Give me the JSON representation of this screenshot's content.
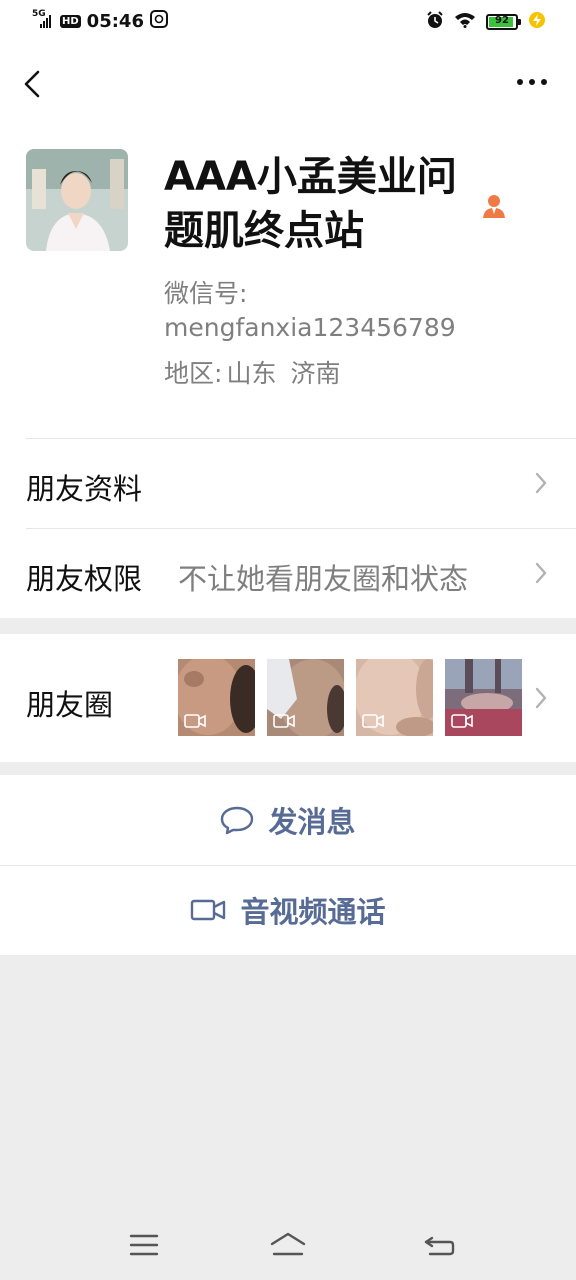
{
  "status_bar": {
    "network": "5G",
    "hd": "HD",
    "time": "05:46",
    "battery": "92",
    "battery_level": 0.92,
    "icons": [
      "signal-icon",
      "hd-icon",
      "data-saver-icon",
      "alarm-icon",
      "wifi-icon",
      "battery-icon",
      "charging-icon"
    ]
  },
  "topbar": {
    "back_icon": "chevron-left-icon",
    "more_icon": "more-horizontal-icon"
  },
  "profile": {
    "name": "AAA小孟美业问题肌终点站",
    "wechat_label": "微信号:",
    "wechat_id": "mengfanxia123456789",
    "region_label": "地区:",
    "region_province": "山东",
    "region_city": "济南",
    "badge_icon": "person-badge-icon"
  },
  "rows": {
    "friend_info": {
      "title": "朋友资料"
    },
    "friend_permissions": {
      "title": "朋友权限",
      "value": "不让她看朋友圈和状态"
    }
  },
  "moments": {
    "title": "朋友圈",
    "thumbnails": [
      {
        "type": "video",
        "icon": "video-icon"
      },
      {
        "type": "video",
        "icon": "video-icon"
      },
      {
        "type": "video",
        "icon": "video-icon"
      },
      {
        "type": "video",
        "icon": "video-icon"
      }
    ]
  },
  "actions": {
    "message": {
      "label": "发消息",
      "icon": "chat-bubble-icon"
    },
    "call": {
      "label": "音视频通话",
      "icon": "video-camera-icon"
    }
  },
  "colors": {
    "accent_link": "#576b95",
    "battery_green": "#3cc13c",
    "badge_orange": "#f07a46",
    "background": "#ededed"
  }
}
